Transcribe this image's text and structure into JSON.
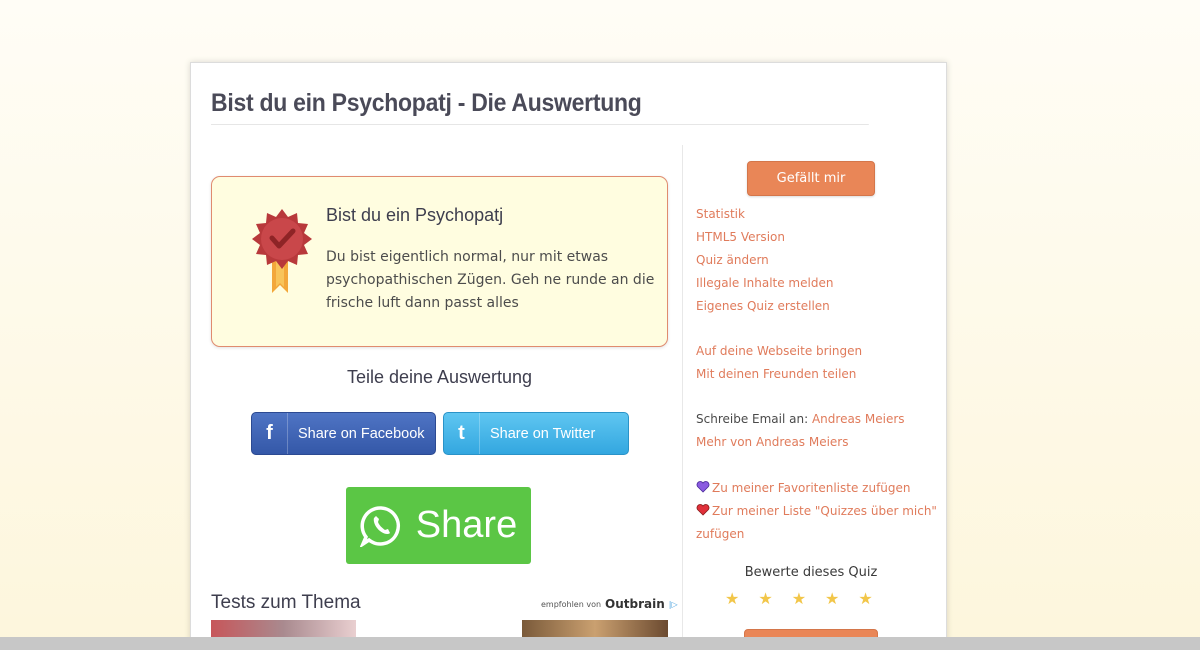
{
  "page": {
    "title": "Bist du ein Psychopatj - Die Auswertung"
  },
  "result": {
    "title": "Bist du ein Psychopatj",
    "text": "Du bist eigentlich normal, nur mit etwas psychopathischen Zügen. Geh ne runde an die frische luft dann passt alles"
  },
  "share": {
    "heading": "Teile deine Auswertung",
    "facebook_label": "Share on Facebook",
    "twitter_label": "Share on Twitter",
    "whatsapp_label": "Share"
  },
  "related": {
    "title": "Tests zum Thema",
    "recommended_by": "empfohlen von",
    "brand": "Outbrain"
  },
  "sidebar": {
    "like_label": "Gefällt mir",
    "links": [
      "Statistik",
      "HTML5 Version",
      "Quiz ändern",
      "Illegale Inhalte melden",
      "Eigenes Quiz erstellen"
    ],
    "links2": [
      "Auf deine Webseite bringen",
      "Mit deinen Freunden teilen"
    ],
    "email_prefix": "Schreibe Email an:",
    "author": "Andreas Meiers",
    "more_from": "Mehr von Andreas Meiers",
    "favorites": "Zu meiner Favoritenliste zufügen",
    "about_me_line1": "Zur meiner Liste \"Quizzes über mich\"",
    "about_me_line2": "zufügen",
    "rate_title": "Bewerte dieses Quiz",
    "stars": [
      "★",
      "★",
      "★",
      "★",
      "★"
    ]
  },
  "colors": {
    "accent": "#e98657",
    "link": "#e07b5b",
    "card_bg": "#fffde0",
    "whatsapp": "#5bc645"
  }
}
